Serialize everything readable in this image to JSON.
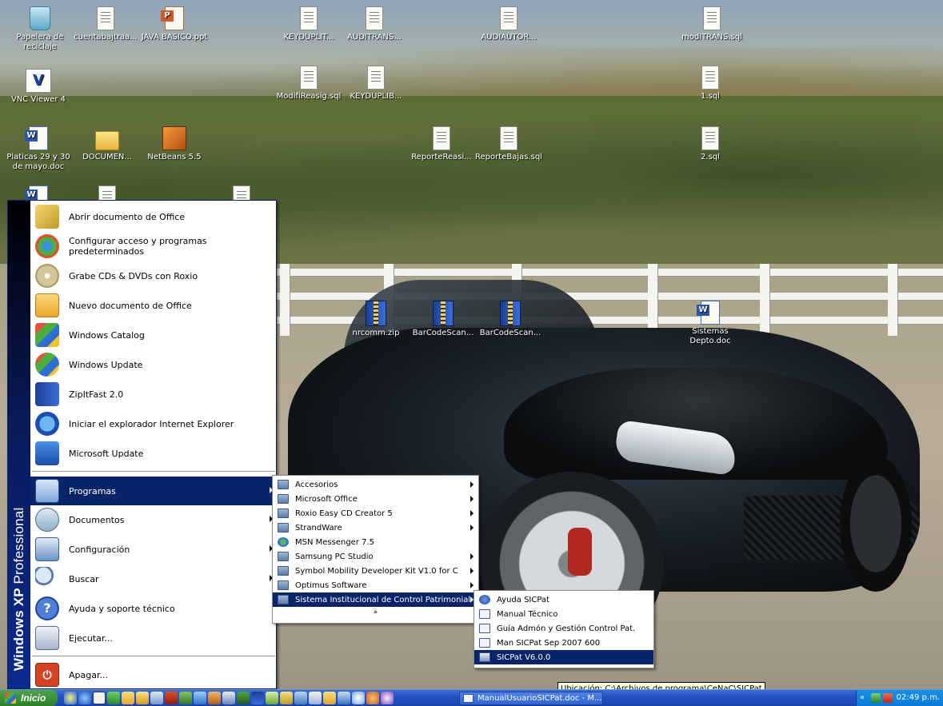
{
  "desktop": {
    "icons": [
      {
        "label": "Papelera de reciclaje",
        "icon": "recycle-bin-icon"
      },
      {
        "label": "cuentabajtraa...",
        "icon": "text-file-icon"
      },
      {
        "label": "JAVA BASICO.ppt",
        "icon": "powerpoint-file-icon"
      },
      {
        "label": "KEYDUPLIT...",
        "icon": "text-file-icon"
      },
      {
        "label": "AUDITRANS...",
        "icon": "text-file-icon"
      },
      {
        "label": "AUDIAUTOR...",
        "icon": "text-file-icon"
      },
      {
        "label": "modiTRANS.sql",
        "icon": "text-file-icon"
      },
      {
        "label": "VNC Viewer 4",
        "icon": "vnc-viewer-icon"
      },
      {
        "label": "ModifiReasig.sql",
        "icon": "text-file-icon"
      },
      {
        "label": "KEYDUPLIB...",
        "icon": "text-file-icon"
      },
      {
        "label": "1.sql",
        "icon": "text-file-icon"
      },
      {
        "label": "Platicas 29 y 30 de mayo.doc",
        "icon": "word-file-icon"
      },
      {
        "label": "DOCUMEN...",
        "icon": "folder-icon"
      },
      {
        "label": "NetBeans 5.5",
        "icon": "netbeans-icon"
      },
      {
        "label": "ReporteReasi...",
        "icon": "text-file-icon"
      },
      {
        "label": "ReporteBajas.sql",
        "icon": "text-file-icon"
      },
      {
        "label": "2.sql",
        "icon": "text-file-icon"
      },
      {
        "label": "nrcomm.zip",
        "icon": "zip-file-icon"
      },
      {
        "label": "BarCodeScan...",
        "icon": "zip-file-icon"
      },
      {
        "label": "BarCodeScan...",
        "icon": "zip-file-icon"
      },
      {
        "label": "Sistemas Depto.doc",
        "icon": "word-file-icon"
      }
    ]
  },
  "start_menu": {
    "side_band": {
      "brand": "Windows XP",
      "edition": "Professional"
    },
    "top_items": [
      {
        "label": "Abrir documento de Office",
        "icon": "office-open-icon"
      },
      {
        "label": "Configurar acceso y programas predeterminados",
        "icon": "set-program-access-icon"
      },
      {
        "label": "Grabe CDs & DVDs con Roxio",
        "icon": "cd-burn-icon"
      },
      {
        "label": "Nuevo documento de Office",
        "icon": "office-new-icon"
      },
      {
        "label": "Windows Catalog",
        "icon": "windows-catalog-icon"
      },
      {
        "label": "Windows Update",
        "icon": "windows-update-icon"
      },
      {
        "label": "ZipItFast 2.0",
        "icon": "zip-icon"
      },
      {
        "label": "Iniciar el explorador Internet Explorer",
        "icon": "internet-explorer-icon"
      },
      {
        "label": "Microsoft Update",
        "icon": "microsoft-update-icon"
      }
    ],
    "bottom_items": [
      {
        "label": "Programas",
        "icon": "programs-icon",
        "has_submenu": true,
        "selected": true
      },
      {
        "label": "Documentos",
        "icon": "documents-icon",
        "has_submenu": true
      },
      {
        "label": "Configuración",
        "icon": "settings-icon",
        "has_submenu": true
      },
      {
        "label": "Buscar",
        "icon": "search-icon",
        "has_submenu": true
      },
      {
        "label": "Ayuda y soporte técnico",
        "icon": "help-icon"
      },
      {
        "label": "Ejecutar...",
        "icon": "run-icon"
      },
      {
        "label": "Apagar...",
        "icon": "shutdown-icon"
      }
    ]
  },
  "programs_menu": {
    "items": [
      {
        "label": "Accesorios",
        "icon": "program-group-icon",
        "has_submenu": true
      },
      {
        "label": "Microsoft Office",
        "icon": "program-group-icon",
        "has_submenu": true
      },
      {
        "label": "Roxio Easy CD Creator 5",
        "icon": "program-group-icon",
        "has_submenu": true
      },
      {
        "label": "StrandWare",
        "icon": "program-group-icon",
        "has_submenu": true
      },
      {
        "label": "MSN Messenger 7.5",
        "icon": "msn-messenger-icon",
        "has_submenu": false
      },
      {
        "label": "Samsung PC Studio",
        "icon": "program-group-icon",
        "has_submenu": true
      },
      {
        "label": "Symbol Mobility Developer Kit V1.0 for C",
        "icon": "program-group-icon",
        "has_submenu": true
      },
      {
        "label": "Optimus Software",
        "icon": "program-group-icon",
        "has_submenu": true
      },
      {
        "label": "Sistema Institucional de Control Patrimonial",
        "icon": "program-group-icon",
        "has_submenu": true,
        "selected": true
      }
    ],
    "more_indicator": "»"
  },
  "sicpat_menu": {
    "items": [
      {
        "label": "Ayuda SICPat",
        "icon": "help-file-icon"
      },
      {
        "label": "Manual Técnico",
        "icon": "word-doc-icon"
      },
      {
        "label": "Guía Admón y Gestión Control Pat.",
        "icon": "word-doc-icon"
      },
      {
        "label": "Man SICPat Sep 2007 600",
        "icon": "word-doc-icon"
      },
      {
        "label": "SICPat V6.0.0",
        "icon": "application-icon",
        "selected": true
      }
    ]
  },
  "tooltip": {
    "text": "Ubicación: C:\\Archivos de programa\\CeNaC\\SICPat"
  },
  "taskbar": {
    "start_label": "Inicio",
    "task_button": "ManualUsuarioSICPat.doc - M...",
    "tray_expand": "«",
    "clock": "02:49 p.m."
  },
  "colors": {
    "selection": "#0a246a",
    "taskbar": "#2454c2",
    "start_button": "#2d7f2a",
    "tooltip_bg": "#ffffe1"
  }
}
